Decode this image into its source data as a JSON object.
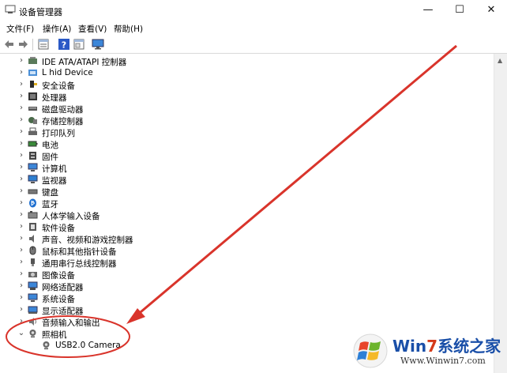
{
  "window": {
    "title": "设备管理器",
    "controls": [
      "—",
      "☐",
      "✕"
    ]
  },
  "menu": [
    "文件(F)",
    "操作(A)",
    "查看(V)",
    "帮助(H)"
  ],
  "toolbar": [
    "back-arrow-icon",
    "forward-arrow-icon",
    "properties-icon",
    "help-icon",
    "show-hide-icon",
    "monitor-icon"
  ],
  "tree": [
    {
      "label": "IDE ATA/ATAPI 控制器",
      "icon": "ide-controller-icon",
      "expanded": false
    },
    {
      "label": "L        hid Device",
      "icon": "hid-device-icon",
      "expanded": false
    },
    {
      "label": "安全设备",
      "icon": "security-device-icon",
      "expanded": false
    },
    {
      "label": "处理器",
      "icon": "processor-icon",
      "expanded": false
    },
    {
      "label": "磁盘驱动器",
      "icon": "disk-drive-icon",
      "expanded": false
    },
    {
      "label": "存储控制器",
      "icon": "storage-controller-icon",
      "expanded": false
    },
    {
      "label": "打印队列",
      "icon": "print-queue-icon",
      "expanded": false
    },
    {
      "label": "电池",
      "icon": "battery-icon",
      "expanded": false
    },
    {
      "label": "固件",
      "icon": "firmware-icon",
      "expanded": false
    },
    {
      "label": "计算机",
      "icon": "computer-icon",
      "expanded": false
    },
    {
      "label": "监视器",
      "icon": "monitor-icon",
      "expanded": false
    },
    {
      "label": "键盘",
      "icon": "keyboard-icon",
      "expanded": false
    },
    {
      "label": "蓝牙",
      "icon": "bluetooth-icon",
      "expanded": false
    },
    {
      "label": "人体学输入设备",
      "icon": "hid-icon",
      "expanded": false
    },
    {
      "label": "软件设备",
      "icon": "software-device-icon",
      "expanded": false
    },
    {
      "label": "声音、视频和游戏控制器",
      "icon": "sound-icon",
      "expanded": false
    },
    {
      "label": "鼠标和其他指针设备",
      "icon": "mouse-icon",
      "expanded": false
    },
    {
      "label": "通用串行总线控制器",
      "icon": "usb-controller-icon",
      "expanded": false
    },
    {
      "label": "图像设备",
      "icon": "imaging-device-icon",
      "expanded": false
    },
    {
      "label": "网络适配器",
      "icon": "network-adapter-icon",
      "expanded": false
    },
    {
      "label": "系统设备",
      "icon": "system-device-icon",
      "expanded": false
    },
    {
      "label": "显示适配器",
      "icon": "display-adapter-icon",
      "expanded": false
    },
    {
      "label": "音频输入和输出",
      "icon": "audio-io-icon",
      "expanded": false
    },
    {
      "label": "照相机",
      "icon": "camera-icon",
      "expanded": true
    },
    {
      "label": "USB2.0 Camera",
      "icon": "camera-icon",
      "child": true
    }
  ],
  "colors": {
    "annotation_red": "#d9342b",
    "watermark_blue": "#1a4fa8",
    "watermark_red": "#d43a1a"
  },
  "watermark": {
    "brand_prefix": "Win",
    "brand_seven": "7",
    "brand_suffix": "系统之家",
    "url": "Www.Winwin7.com"
  }
}
